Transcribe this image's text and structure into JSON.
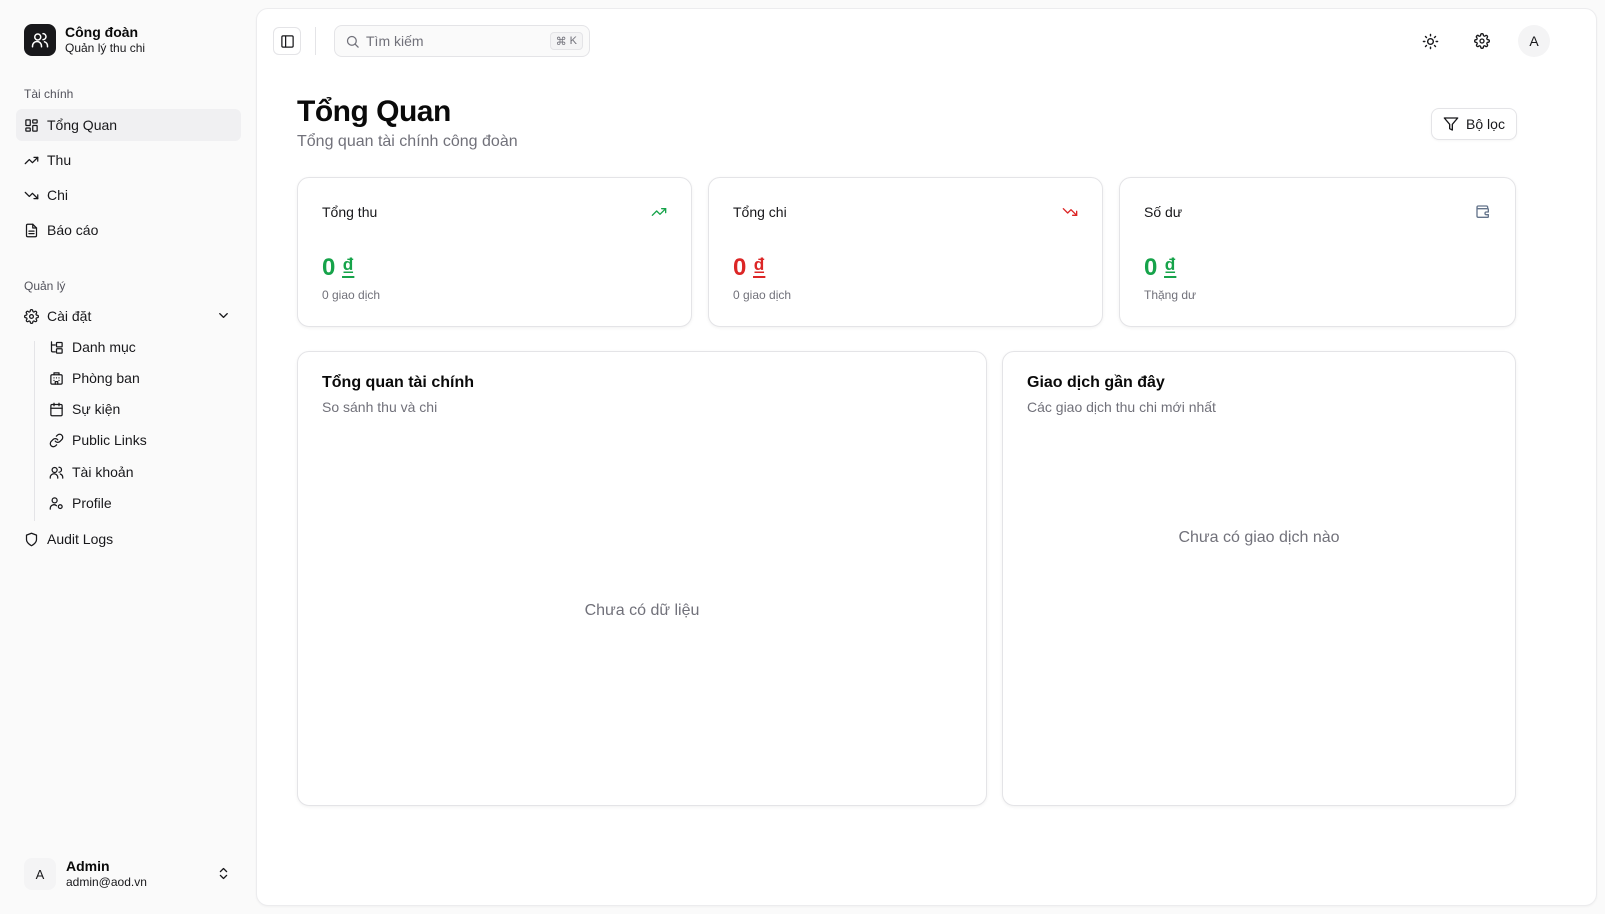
{
  "brand": {
    "title": "Công đoàn",
    "subtitle": "Quản lý thu chi"
  },
  "sidebar": {
    "group_finance": "Tài chính",
    "finance_items": [
      {
        "label": "Tổng Quan",
        "icon": "layout-dashboard-icon",
        "active": true
      },
      {
        "label": "Thu",
        "icon": "trending-up-icon"
      },
      {
        "label": "Chi",
        "icon": "trending-down-icon"
      },
      {
        "label": "Báo cáo",
        "icon": "file-text-icon"
      }
    ],
    "group_manage": "Quản lý",
    "settings_label": "Cài đặt",
    "settings_children": [
      {
        "label": "Danh mục",
        "icon": "folder-tree-icon"
      },
      {
        "label": "Phòng ban",
        "icon": "building-icon"
      },
      {
        "label": "Sự kiện",
        "icon": "calendar-icon"
      },
      {
        "label": "Public Links",
        "icon": "link-icon"
      },
      {
        "label": "Tài khoản",
        "icon": "users-icon"
      },
      {
        "label": "Profile",
        "icon": "user-cog-icon"
      }
    ],
    "audit_label": "Audit Logs"
  },
  "user": {
    "initial": "A",
    "name": "Admin",
    "email": "admin@aod.vn"
  },
  "topbar": {
    "search_placeholder": "Tìm kiếm",
    "shortcut_symbol": "⌘",
    "shortcut_key": "K",
    "avatar_initial": "A"
  },
  "page": {
    "title": "Tổng Quan",
    "subtitle": "Tổng quan tài chính công đoàn",
    "filter_label": "Bộ lọc"
  },
  "stats": [
    {
      "label": "Tổng thu",
      "number": "0",
      "currency": "₫",
      "note": "0 giao dịch",
      "color": "#16a34a",
      "icon": "trending-up-icon"
    },
    {
      "label": "Tổng chi",
      "number": "0",
      "currency": "₫",
      "note": "0 giao dịch",
      "color": "#dc2626",
      "icon": "trending-down-icon"
    },
    {
      "label": "Số dư",
      "number": "0",
      "currency": "₫",
      "note": "Thặng dư",
      "color": "#16a34a",
      "icon": "wallet-icon"
    }
  ],
  "overview_panel": {
    "title": "Tổng quan tài chính",
    "subtitle": "So sánh thu và chi",
    "empty": "Chưa có dữ liệu"
  },
  "recent_panel": {
    "title": "Giao dịch gần đây",
    "subtitle": "Các giao dịch thu chi mới nhất",
    "empty": "Chưa có giao dịch nào"
  }
}
